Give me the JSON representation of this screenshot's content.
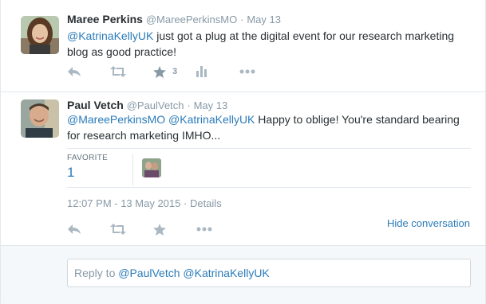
{
  "tweets": [
    {
      "name": "Maree Perkins",
      "handle": "@MareePerkinsMO",
      "separator": "·",
      "date": "May 13",
      "text_mention": "@KatrinaKellyUK",
      "text_body": " just got a plug at the digital event for our research marketing blog as good practice!",
      "favorite_count": "3"
    },
    {
      "name": "Paul Vetch",
      "handle": "@PaulVetch",
      "separator": "·",
      "date": "May 13",
      "text_mention1": "@MareePerkinsMO",
      "text_mention2": "@KatrinaKellyUK",
      "text_body": " Happy to oblige!  You're standard bearing for research marketing IMHO...",
      "stats_label": "FAVORITE",
      "stats_value": "1",
      "timestamp": "12:07 PM - 13 May 2015",
      "details_label": "Details"
    }
  ],
  "hide_conversation": "Hide conversation",
  "reply": {
    "prefix": "Reply to ",
    "mentions": "@PaulVetch @KatrinaKellyUK"
  },
  "colors": {
    "link": "#2b7bb9",
    "icon": "#aab8c2",
    "muted": "#8899a6"
  },
  "icons": [
    "reply-icon",
    "retweet-icon",
    "favorite-star-icon",
    "analytics-icon",
    "more-icon"
  ]
}
